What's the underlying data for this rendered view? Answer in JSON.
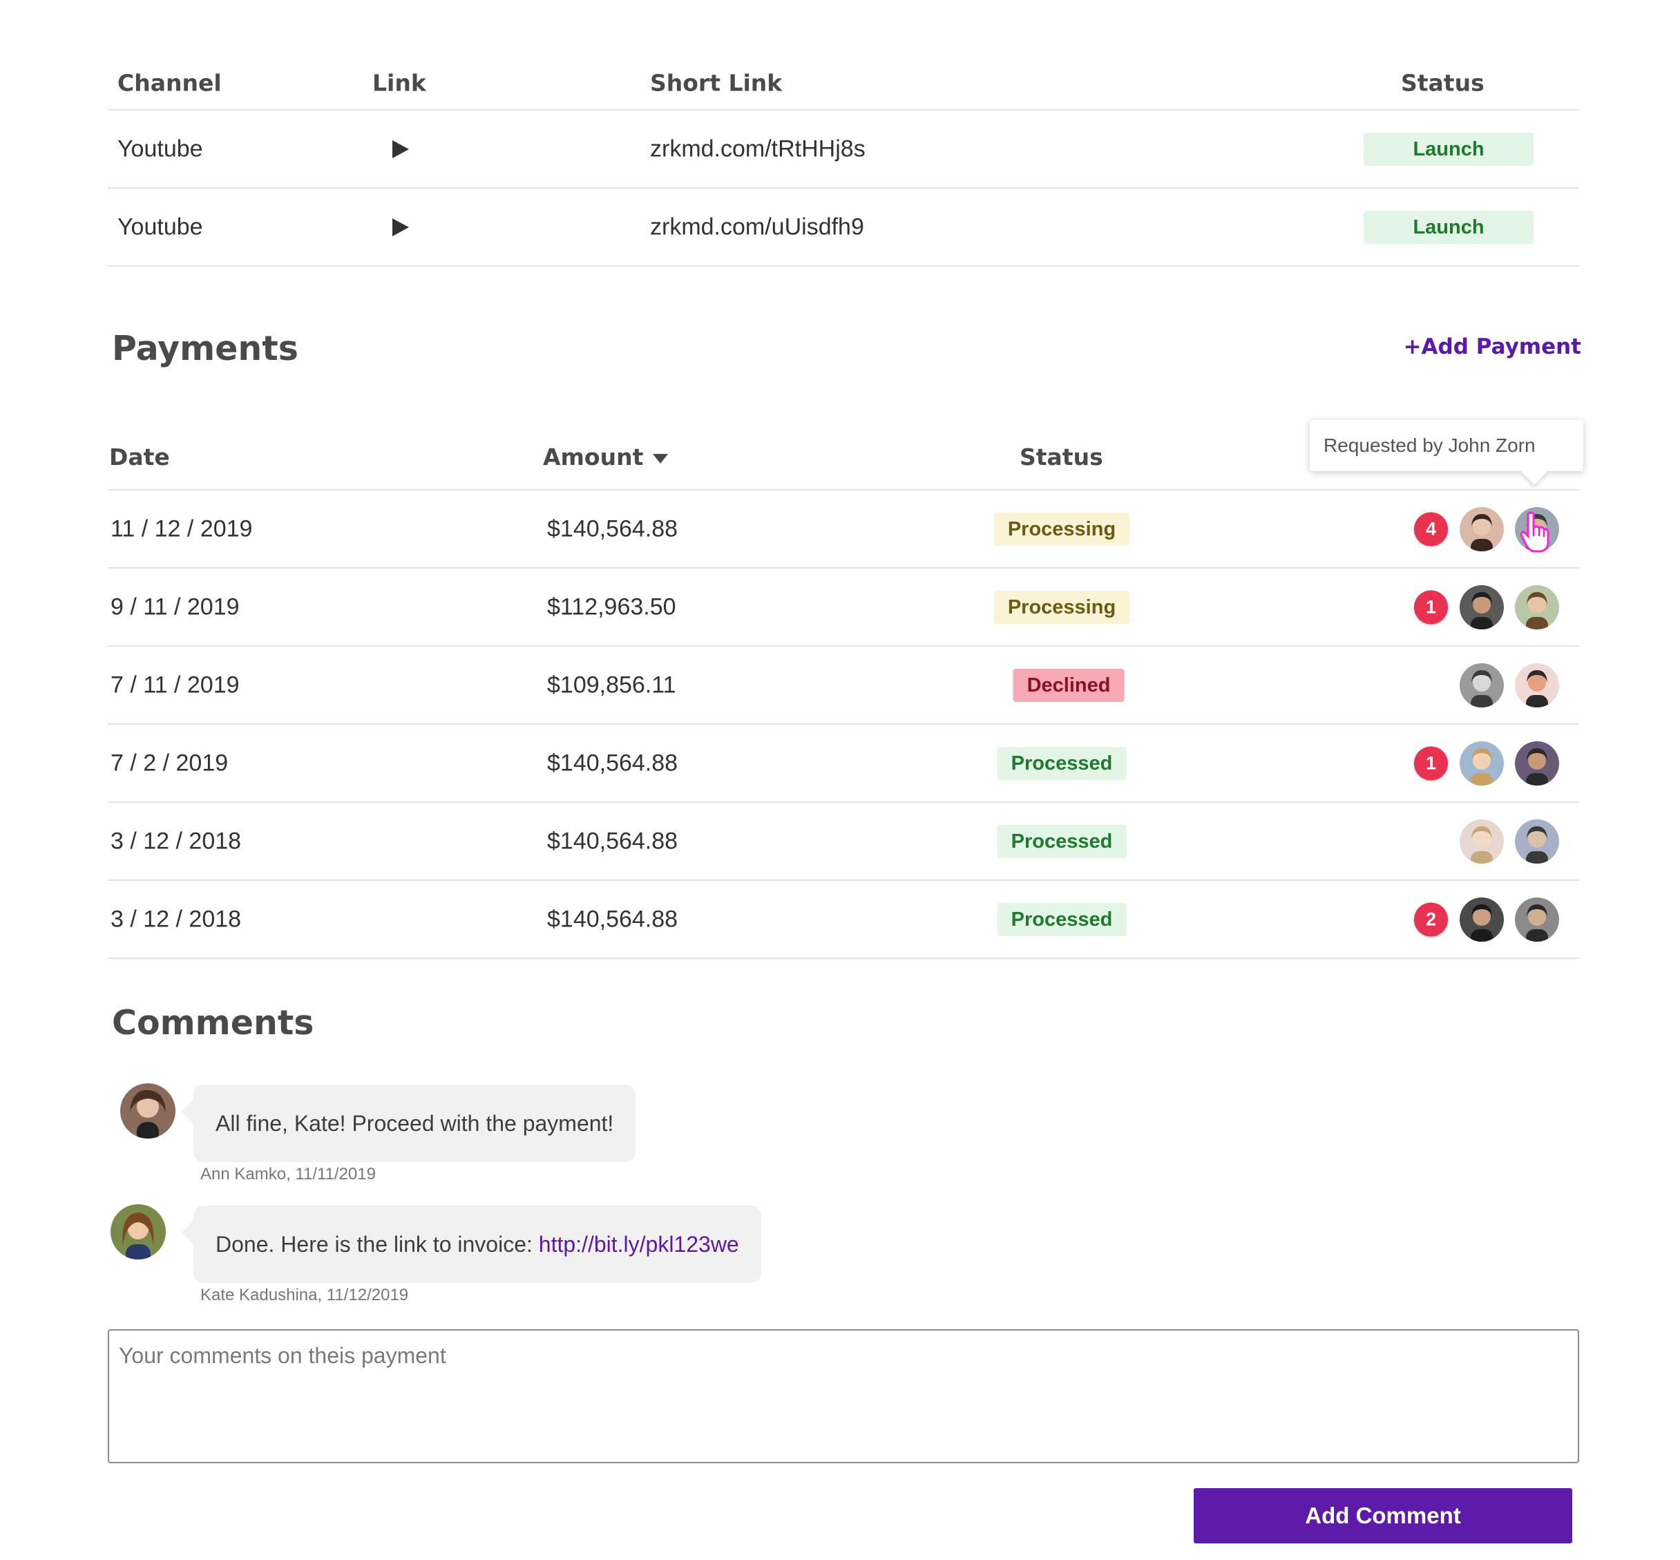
{
  "channels_table": {
    "headers": {
      "channel": "Channel",
      "link": "Link",
      "short_link": "Short Link",
      "status": "Status"
    },
    "rows": [
      {
        "channel": "Youtube",
        "link_icon": "play-icon",
        "short_link": "zrkmd.com/tRtHHj8s",
        "status": "Launch"
      },
      {
        "channel": "Youtube",
        "link_icon": "play-icon",
        "short_link": "zrkmd.com/uUisdfh9",
        "status": "Launch"
      }
    ]
  },
  "payments": {
    "title": "Payments",
    "add_label": "+Add Payment",
    "headers": {
      "date": "Date",
      "amount": "Amount",
      "status": "Status"
    },
    "tooltip": "Requested by John Zorn",
    "rows": [
      {
        "date": "11 / 12 / 2019",
        "amount": "$140,564.88",
        "status": "Processing",
        "count": "4"
      },
      {
        "date": "9 / 11 / 2019",
        "amount": "$112,963.50",
        "status": "Processing",
        "count": "1"
      },
      {
        "date": "7 / 11 / 2019",
        "amount": "$109,856.11",
        "status": "Declined",
        "count": ""
      },
      {
        "date": "7 / 2 / 2019",
        "amount": "$140,564.88",
        "status": "Processed",
        "count": "1"
      },
      {
        "date": "3 / 12 / 2018",
        "amount": "$140,564.88",
        "status": "Processed",
        "count": ""
      },
      {
        "date": "3 / 12 / 2018",
        "amount": "$140,564.88",
        "status": "Processed",
        "count": "2"
      }
    ]
  },
  "comments": {
    "title": "Comments",
    "items": [
      {
        "text": "All fine, Kate! Proceed with the payment!",
        "link": "",
        "meta": "Ann Kamko, 11/11/2019"
      },
      {
        "text": "Done. Here is the link to invoice: ",
        "link": "http://bit.ly/pkl123we",
        "meta": "Kate Kadushina, 11/12/2019"
      }
    ],
    "input_placeholder": "Your comments on theis payment",
    "submit_label": "Add Comment"
  },
  "colors": {
    "accent": "#5e1aa8",
    "processing_bg": "#fbf3d5",
    "declined_bg": "#f7a9b5",
    "processed_bg": "#e3f5e6",
    "count_badge": "#e8324f"
  }
}
